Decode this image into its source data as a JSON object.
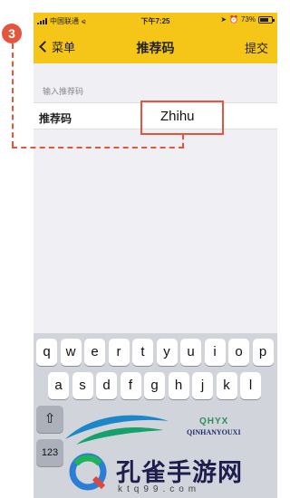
{
  "annotation": {
    "step_number": "3"
  },
  "status_bar": {
    "carrier": "中国联通",
    "time": "下午7:25",
    "battery": "73%",
    "battery_level": 0.73
  },
  "nav": {
    "back_label": "菜单",
    "title": "推荐码",
    "submit_label": "提交"
  },
  "form": {
    "section_label": "输入推荐码",
    "field_label": "推荐码",
    "field_value": "Zhihu"
  },
  "keyboard": {
    "row1": [
      "q",
      "w",
      "e",
      "r",
      "t",
      "y",
      "u",
      "i",
      "o",
      "p"
    ],
    "row2": [
      "a",
      "s",
      "d",
      "f",
      "g",
      "h",
      "j",
      "k",
      "l"
    ],
    "shift_icon": "shift-icon",
    "numbers_label": "123"
  },
  "watermark": {
    "logo_text": "QHYX",
    "logo_subtext": "QINHANYOUXI",
    "brand": "孔雀手游网",
    "domain": "ktq99.com"
  },
  "colors": {
    "nav_bar": "#f5c518",
    "annotation": "#e4553e",
    "keyboard_bg": "#d1d4db"
  }
}
